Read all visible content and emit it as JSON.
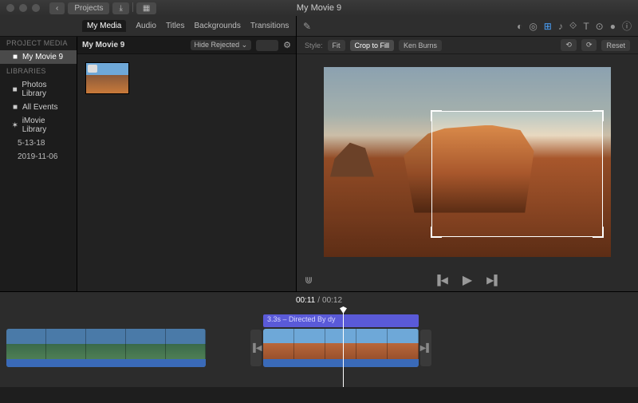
{
  "window": {
    "title": "My Movie 9"
  },
  "toolbar_nav": {
    "back": "‹",
    "projects": "Projects",
    "import": "⤓",
    "grid": "▦"
  },
  "sidebar": {
    "project_header": "PROJECT MEDIA",
    "project": "My Movie 9",
    "libraries_header": "LIBRARIES",
    "items": [
      {
        "icon": "■",
        "label": "Photos Library"
      },
      {
        "icon": "■",
        "label": "All Events"
      },
      {
        "icon": "✶",
        "label": "iMovie Library"
      }
    ],
    "sub": [
      "5-13-18",
      "2019-11-06"
    ]
  },
  "tabs": [
    "My Media",
    "Audio",
    "Titles",
    "Backgrounds",
    "Transitions"
  ],
  "filterbar": {
    "crumb": "My Movie 9",
    "filter_label": "Hide Rejected",
    "settings_icon": "⚙"
  },
  "viewer": {
    "wand": "✎",
    "icons": [
      "◐",
      "◎",
      "⊞",
      "♪",
      "⟐",
      "T",
      "⊙",
      "●",
      "ⓘ"
    ],
    "style_label": "Style:",
    "styles": [
      "Fit",
      "Crop to Fill",
      "Ken Burns"
    ],
    "right_btns": [
      "⟲",
      "⟳"
    ],
    "reset": "Reset",
    "mic": "⋓",
    "prev": "▐◀",
    "play": "▶",
    "next": "▶▌"
  },
  "timeline": {
    "current": "00:11",
    "total": "00:12",
    "clip_title": "3.3s – Directed By dy",
    "cap_l": "▐◀",
    "cap_r": "▶▌"
  }
}
